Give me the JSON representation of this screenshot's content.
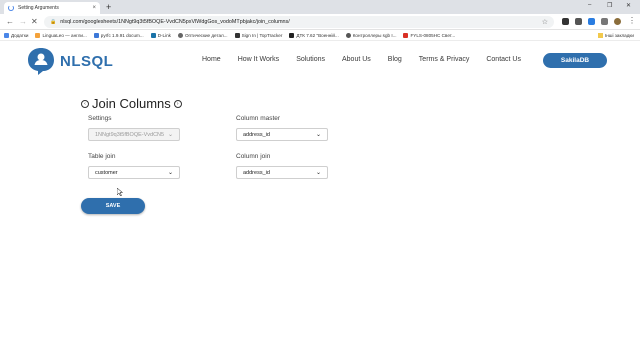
{
  "browser": {
    "tab_title": "Setting Arguments",
    "tab_close": "×",
    "new_tab": "+",
    "url": "nlsql.com/googlesheets/1NNgt9q3t5fBOQE-VvdCN5pxVlWdgGos_vodoMTpbjakc/join_columns/",
    "window_controls": [
      "–",
      "❐",
      "✕"
    ],
    "bookmarks": [
      {
        "label": "Додатки",
        "color": "#4a86e8"
      },
      {
        "label": "LinguaLeo — англи...",
        "color": "#f4a23b"
      },
      {
        "label": "pyrfc 1.9.91 docum...",
        "color": "#3c78d8"
      },
      {
        "label": "D-Link",
        "color": "#1a73a8"
      },
      {
        "label": "Оптические детал...",
        "color": "#666666"
      },
      {
        "label": "Sign In | TopTracker",
        "color": "#333333"
      },
      {
        "label": "ДТК 7.62 \"Военній...",
        "color": "#222222"
      },
      {
        "label": "Контроллеры sgb I...",
        "color": "#555555"
      },
      {
        "label": "FYLS-0805HC Свет...",
        "color": "#d93025"
      }
    ],
    "bookmarks_other": "Інші закладки"
  },
  "site": {
    "logo_text": "NLSQL",
    "nav": [
      "Home",
      "How It Works",
      "Solutions",
      "About Us",
      "Blog",
      "Terms & Privacy",
      "Contact Us"
    ],
    "cta_label": "SakilaDB",
    "brand_color": "#2f6fad"
  },
  "form": {
    "title": "Join Columns",
    "settings_label": "Settings",
    "settings_value": "1NNgt9q3t5fBOQE-VvdCN5",
    "column_master_label": "Column master",
    "column_master_value": "address_id",
    "table_join_label": "Table join",
    "table_join_value": "customer",
    "column_join_label": "Column join",
    "column_join_value": "address_id",
    "save_label": "SAVE"
  }
}
